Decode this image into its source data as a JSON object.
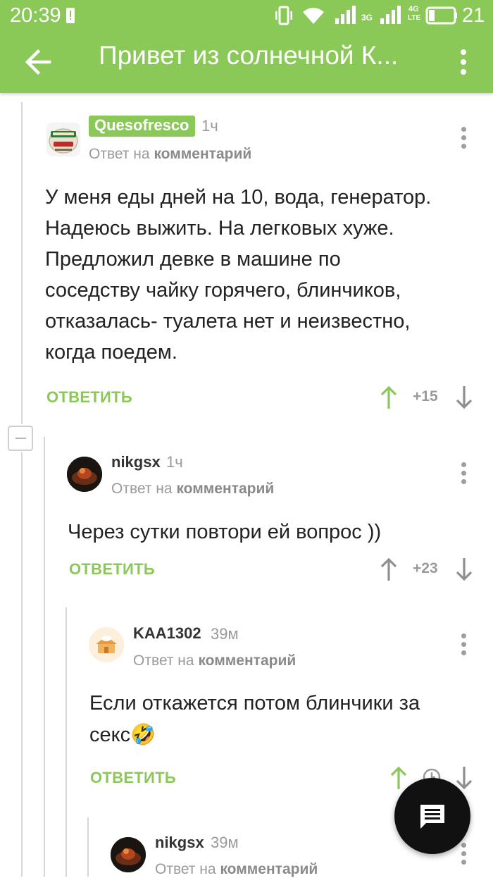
{
  "status_bar": {
    "time": "20:39",
    "network_3g": "3G",
    "network_4g": "4G",
    "network_lte": "LTE",
    "battery_percent": "21"
  },
  "app_bar": {
    "title": "Привет из солнечной К...",
    "back_icon": "arrow-left-icon",
    "menu_icon": "more-vertical-icon"
  },
  "colors": {
    "accent": "#8ac858",
    "fab": "#111111",
    "meta_text": "#9a9a9a"
  },
  "reply_to_prefix": "Ответ на",
  "reply_to_link": "комментарий",
  "comments": [
    {
      "author": "Quesofresco",
      "time": "1ч",
      "text": "У меня еды дней на 10, вода, генератор. Надеюсь выжить. На легковых хуже. Предложил девке в машине по соседству чайку горячего, блинчиков, отказалась- туалета нет и неизвестно, когда поедем.",
      "lines": [
        "У меня еды дней на 10, вода, генератор.",
        "Надеюсь выжить. На легковых хуже.",
        "Предложил девке в машине по",
        "соседству чайку горячего, блинчиков,",
        "отказалась- туалета нет и неизвестно,",
        "когда поедем."
      ],
      "reply_label": "ОТВЕТИТЬ",
      "rating": "+15"
    },
    {
      "author": "nikgsx",
      "time": "1ч",
      "lines": [
        "Через сутки повтори ей вопрос ))"
      ],
      "reply_label": "ОТВЕТИТЬ",
      "rating": "+23"
    },
    {
      "author": "KAA1302",
      "time": "39м",
      "lines": [
        "Если откажется потом блинчики за",
        "секс"
      ],
      "emoji": "🤣",
      "reply_label": "ОТВЕТИТЬ"
    },
    {
      "author": "nikgsx",
      "time": "39м"
    }
  ],
  "fab_icon": "comment-icon"
}
